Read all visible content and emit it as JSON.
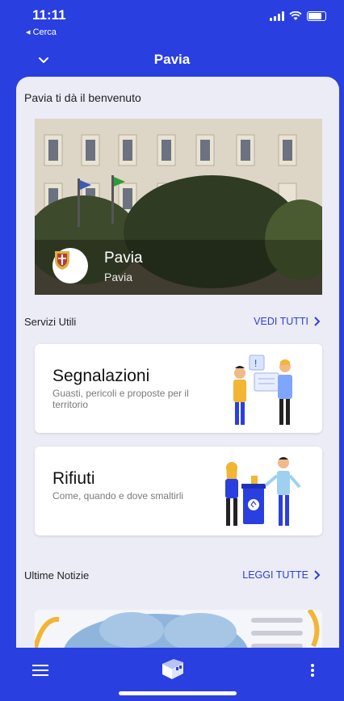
{
  "status_bar": {
    "time": "11:11",
    "back_app": "◂ Cerca"
  },
  "header": {
    "title": "Pavia"
  },
  "welcome": {
    "text": "Pavia ti dà il benvenuto"
  },
  "hero": {
    "title": "Pavia",
    "subtitle": "Pavia"
  },
  "services": {
    "label": "Servizi Utili",
    "link": "VEDI TUTTI",
    "cards": [
      {
        "title": "Segnalazioni",
        "description": "Guasti, pericoli e proposte per il territorio"
      },
      {
        "title": "Rifiuti",
        "description": "Come, quando e dove smaltirli"
      }
    ]
  },
  "news": {
    "label": "Ultime Notizie",
    "link": "LEGGI TUTTE"
  },
  "colors": {
    "accent": "#2a3fe0",
    "background": "#ececf6",
    "card": "#ffffff"
  },
  "icons": {
    "nav": "chevron-down-icon",
    "menu": "menu-icon",
    "logo": "app-logo-icon",
    "more": "more-vertical-icon"
  }
}
